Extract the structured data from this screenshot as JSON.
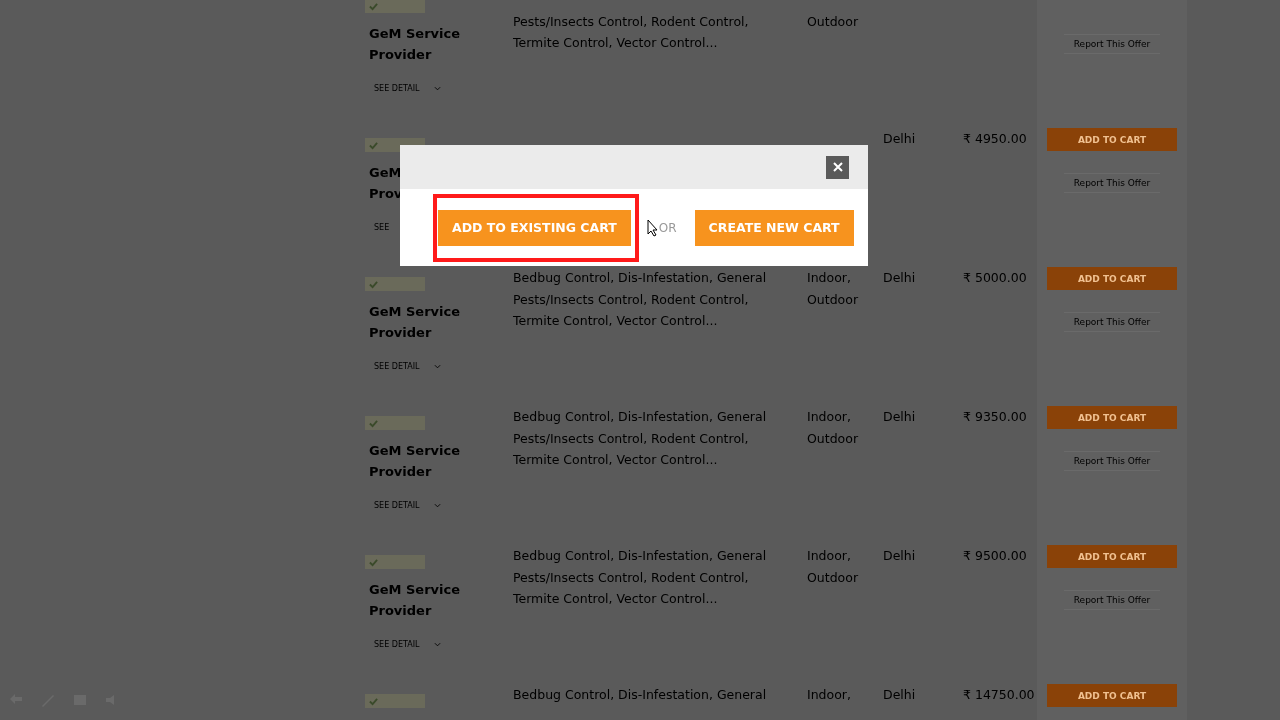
{
  "offers": [
    {
      "provider": [
        "GeM Service",
        "Provider"
      ],
      "details_link": "SEE DETAIL",
      "description": [
        "Pests/Insects Control, Rodent Control,",
        "Termite Control, Vector Control..."
      ],
      "type": [
        "Outdoor"
      ],
      "report_link": "Report This Offer"
    },
    {
      "provider": [
        "GeM",
        "Prov"
      ],
      "details_link": "SEE",
      "location": "Delhi",
      "price": "₹ 4950.00",
      "cart_button": "ADD TO CART",
      "report_link": "Report This Offer"
    },
    {
      "provider": [
        "GeM Service",
        "Provider"
      ],
      "details_link": "SEE DETAIL",
      "description": [
        "Bedbug Control, Dis-Infestation, General",
        "Pests/Insects Control, Rodent Control,",
        "Termite Control, Vector Control..."
      ],
      "type": [
        "Indoor,",
        "Outdoor"
      ],
      "location": "Delhi",
      "price": "₹ 5000.00",
      "cart_button": "ADD TO CART",
      "report_link": "Report This Offer"
    },
    {
      "provider": [
        "GeM Service",
        "Provider"
      ],
      "details_link": "SEE DETAIL",
      "description": [
        "Bedbug Control, Dis-Infestation, General",
        "Pests/Insects Control, Rodent Control,",
        "Termite Control, Vector Control..."
      ],
      "type": [
        "Indoor,",
        "Outdoor"
      ],
      "location": "Delhi",
      "price": "₹ 9350.00",
      "cart_button": "ADD TO CART",
      "report_link": "Report This Offer"
    },
    {
      "provider": [
        "GeM Service",
        "Provider"
      ],
      "details_link": "SEE DETAIL",
      "description": [
        "Bedbug Control, Dis-Infestation, General",
        "Pests/Insects Control, Rodent Control,",
        "Termite Control, Vector Control..."
      ],
      "type": [
        "Indoor,",
        "Outdoor"
      ],
      "location": "Delhi",
      "price": "₹ 9500.00",
      "cart_button": "ADD TO CART",
      "report_link": "Report This Offer"
    },
    {
      "description": [
        "Bedbug Control, Dis-Infestation, General"
      ],
      "type": [
        "Indoor,"
      ],
      "location": "Delhi",
      "price": "₹ 14750.00",
      "cart_button": "ADD TO CART"
    }
  ],
  "modal": {
    "primary_button": "ADD TO EXISTING CART",
    "highlighted": true,
    "separator": "OR",
    "secondary_button": "CREATE NEW CART"
  }
}
